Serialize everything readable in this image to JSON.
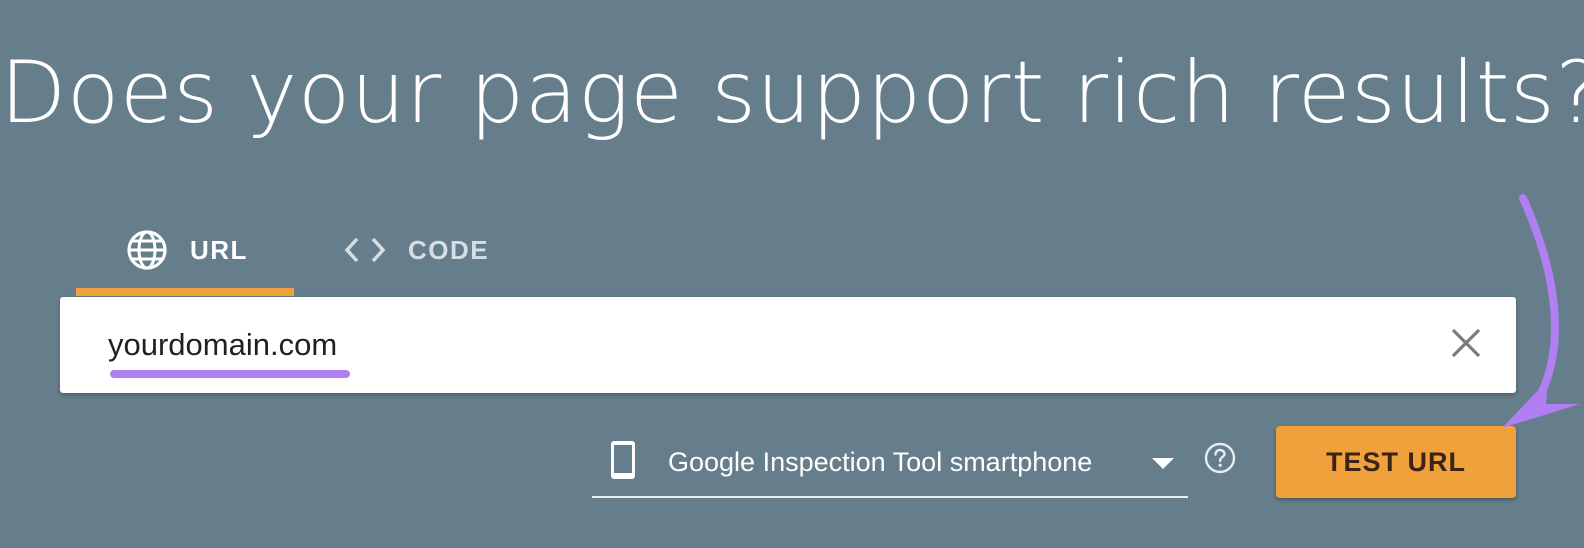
{
  "headline": "Does your page support rich results?",
  "tabs": [
    {
      "label": "URL",
      "icon": "globe-icon",
      "active": true
    },
    {
      "label": "CODE",
      "icon": "code-brackets-icon",
      "active": false
    }
  ],
  "url_input": {
    "value": "yourdomain.com"
  },
  "clear_icon": "close-icon",
  "device_select": {
    "icon": "smartphone-icon",
    "selected": "Google Inspection Tool smartphone"
  },
  "help_icon": "help-circle-icon",
  "test_button": {
    "label": "TEST URL"
  },
  "colors": {
    "background": "#667d8b",
    "accent": "#f1a13c",
    "annotation": "#b07ff2"
  }
}
